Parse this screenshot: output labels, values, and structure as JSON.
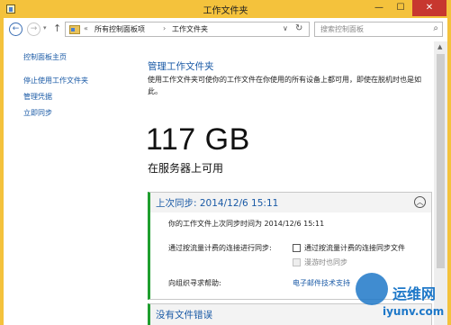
{
  "window": {
    "title": "工作文件夹",
    "minimize": "—",
    "maximize": "☐",
    "close": "✕"
  },
  "nav": {
    "back": "←",
    "forward": "→",
    "forward_dropdown": "▾",
    "up": "↑",
    "address_chevron": "«",
    "breadcrumbs": [
      "所有控制面板项",
      "工作文件夹"
    ],
    "separator": "›",
    "address_dropdown": "∨",
    "refresh": "↻",
    "search_placeholder": "搜索控制面板",
    "search_icon": "⌕"
  },
  "sidebar": {
    "items": [
      {
        "label": "控制面板主页"
      },
      {
        "label": "停止使用工作文件夹"
      },
      {
        "label": "管理凭据"
      },
      {
        "label": "立即同步"
      }
    ]
  },
  "main": {
    "title": "管理工作文件夹",
    "description": "使用工作文件夹可使你的工作文件在你使用的所有设备上都可用，即使在脱机时也是如此。",
    "size": "117 GB",
    "size_caption": "在服务器上可用"
  },
  "sync_panel": {
    "title": "上次同步: 2014/12/6 15:11",
    "collapse_icon": "︿",
    "last_sync_text": "你的工作文件上次同步时间为 2014/12/6 15:11",
    "metered_label": "通过按流量计费的连接进行同步:",
    "metered_checkbox_label": "通过按流量计费的连接同步文件",
    "roaming_checkbox_label": "漫游时也同步",
    "help_label": "向组织寻求帮助:",
    "email_link": "电子邮件技术支持"
  },
  "errors_panel": {
    "title": "没有文件错误"
  },
  "watermark": {
    "cn": "运维网",
    "url": "iyunv.com"
  },
  "colors": {
    "titlebar": "#f4c23c",
    "link": "#1a5aa6",
    "status_green": "#1f9e2e",
    "close_red": "#c7372f"
  }
}
